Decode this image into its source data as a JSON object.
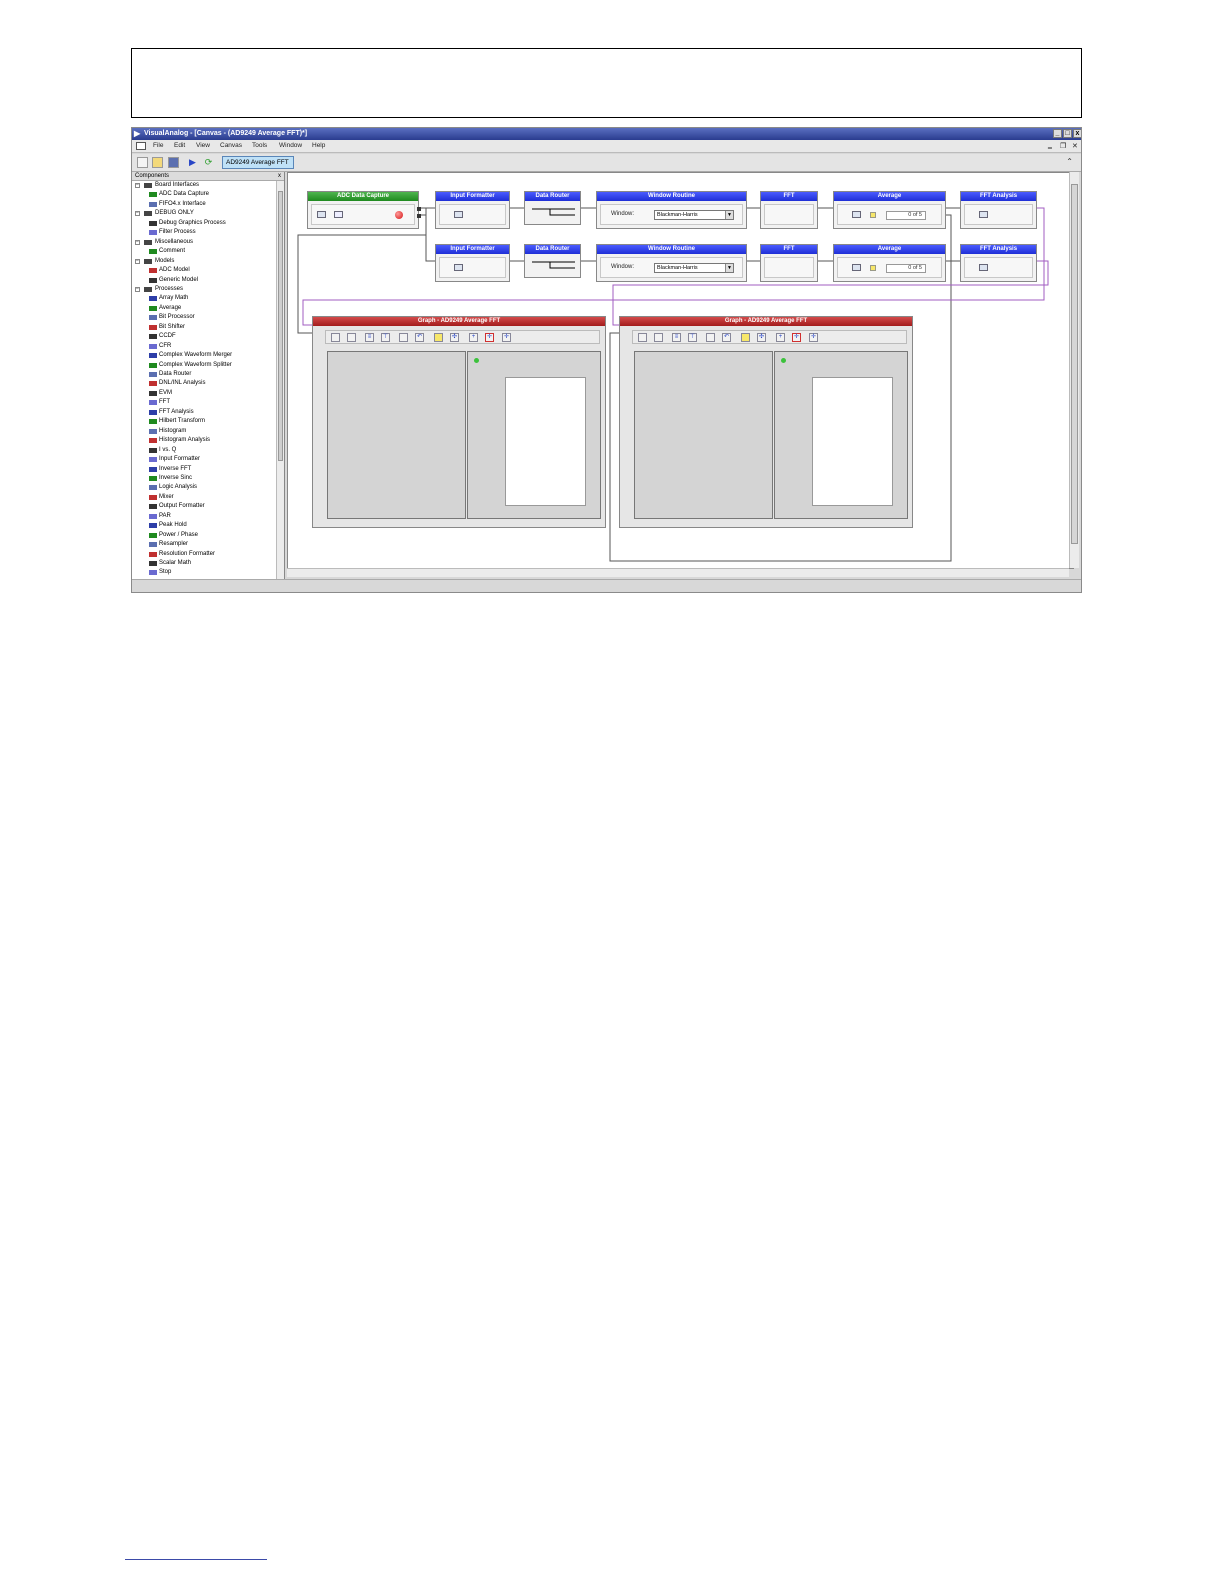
{
  "window": {
    "title": "VisualAnalog - [Canvas - (AD9249 Average FFT)*]",
    "minimize": "_",
    "maximize": "□",
    "close": "x"
  },
  "menu": {
    "items": [
      "File",
      "Edit",
      "View",
      "Canvas",
      "Tools",
      "Window",
      "Help"
    ]
  },
  "toolbar": {
    "tab_label": "AD9249 Average FFT"
  },
  "components_panel": {
    "title": "Components",
    "close": "x",
    "tree": [
      {
        "label": "Board Interfaces",
        "level": 0
      },
      {
        "label": "ADC Data Capture",
        "level": 1
      },
      {
        "label": "FIFO4.x Interface",
        "level": 1
      },
      {
        "label": "DEBUG ONLY",
        "level": 0
      },
      {
        "label": "Debug Graphics Process",
        "level": 1
      },
      {
        "label": "Filter Process",
        "level": 1
      },
      {
        "label": "Miscellaneous",
        "level": 0
      },
      {
        "label": "Comment",
        "level": 1
      },
      {
        "label": "Models",
        "level": 0
      },
      {
        "label": "ADC Model",
        "level": 1
      },
      {
        "label": "Generic Model",
        "level": 1
      },
      {
        "label": "Processes",
        "level": 0
      },
      {
        "label": "Array Math",
        "level": 1
      },
      {
        "label": "Average",
        "level": 1
      },
      {
        "label": "Bit Processor",
        "level": 1
      },
      {
        "label": "Bit Shifter",
        "level": 1
      },
      {
        "label": "CCDF",
        "level": 1
      },
      {
        "label": "CFR",
        "level": 1
      },
      {
        "label": "Complex Waveform Merger",
        "level": 1
      },
      {
        "label": "Complex Waveform Splitter",
        "level": 1
      },
      {
        "label": "Data Router",
        "level": 1
      },
      {
        "label": "DNL/INL Analysis",
        "level": 1
      },
      {
        "label": "EVM",
        "level": 1
      },
      {
        "label": "FFT",
        "level": 1
      },
      {
        "label": "FFT Analysis",
        "level": 1
      },
      {
        "label": "Hilbert Transform",
        "level": 1
      },
      {
        "label": "Histogram",
        "level": 1
      },
      {
        "label": "Histogram Analysis",
        "level": 1
      },
      {
        "label": "I vs. Q",
        "level": 1
      },
      {
        "label": "Input Formatter",
        "level": 1
      },
      {
        "label": "Inverse FFT",
        "level": 1
      },
      {
        "label": "Inverse Sinc",
        "level": 1
      },
      {
        "label": "Logic Analysis",
        "level": 1
      },
      {
        "label": "Mixer",
        "level": 1
      },
      {
        "label": "Output Formatter",
        "level": 1
      },
      {
        "label": "PAR",
        "level": 1
      },
      {
        "label": "Peak Hold",
        "level": 1
      },
      {
        "label": "Power / Phase",
        "level": 1
      },
      {
        "label": "Resampler",
        "level": 1
      },
      {
        "label": "Resolution Formatter",
        "level": 1
      },
      {
        "label": "Scalar Math",
        "level": 1
      },
      {
        "label": "Stop",
        "level": 1
      }
    ]
  },
  "canvas": {
    "adc_capture": {
      "title": "ADC Data Capture"
    },
    "chain": [
      {
        "input_formatter": "Input Formatter",
        "data_router": "Data Router",
        "window_routine": "Window Routine",
        "window_label": "Window:",
        "window_value": "Blackman-Harris",
        "fft": "FFT",
        "average": "Average",
        "average_count": "0 of 5",
        "fft_analysis": "FFT Analysis"
      },
      {
        "input_formatter": "Input Formatter",
        "data_router": "Data Router",
        "window_routine": "Window Routine",
        "window_label": "Window:",
        "window_value": "Blackman-Harris",
        "fft": "FFT",
        "average": "Average",
        "average_count": "0 of 5",
        "fft_analysis": "FFT Analysis"
      }
    ],
    "graphs": [
      {
        "title": "Graph - AD9249 Average FFT"
      },
      {
        "title": "Graph - AD9249 Average FFT"
      }
    ]
  },
  "colors": {
    "block_header": "#1f2fd6",
    "capture_header": "#1f8a1f",
    "graph_header": "#a31c1c",
    "wire_purple": "#a25cc2"
  }
}
